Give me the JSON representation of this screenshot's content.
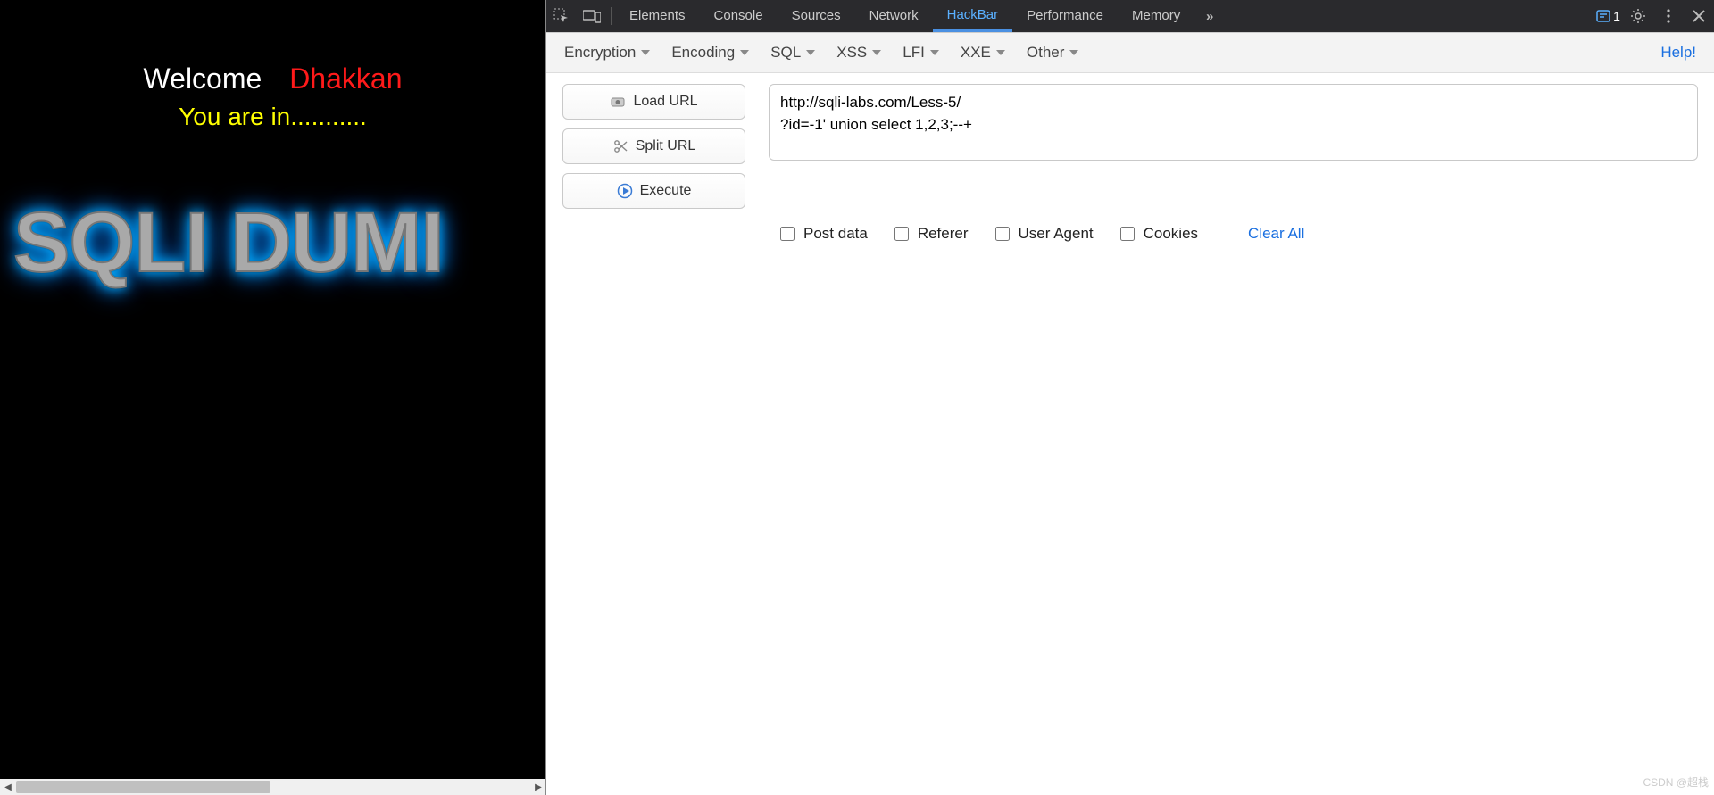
{
  "page": {
    "welcome_prefix": "Welcome",
    "welcome_name": "Dhakkan",
    "status_line": "You are in...........",
    "logo_text": "SQLI DUMI"
  },
  "devtools": {
    "tabs": [
      "Elements",
      "Console",
      "Sources",
      "Network",
      "HackBar",
      "Performance",
      "Memory"
    ],
    "active_tab": "HackBar",
    "issues_count": "1"
  },
  "hackbar": {
    "menus": {
      "encryption": "Encryption",
      "encoding": "Encoding",
      "sql": "SQL",
      "xss": "XSS",
      "lfi": "LFI",
      "xxe": "XXE",
      "other": "Other"
    },
    "help_label": "Help!",
    "buttons": {
      "load_url": "Load URL",
      "split_url": "Split URL",
      "execute": "Execute"
    },
    "url_value": "http://sqli-labs.com/Less-5/\n?id=-1' union select 1,2,3;--+",
    "options": {
      "post_data": "Post data",
      "referer": "Referer",
      "user_agent": "User Agent",
      "cookies": "Cookies"
    },
    "clear_all": "Clear All"
  },
  "watermark": "CSDN @超栈"
}
